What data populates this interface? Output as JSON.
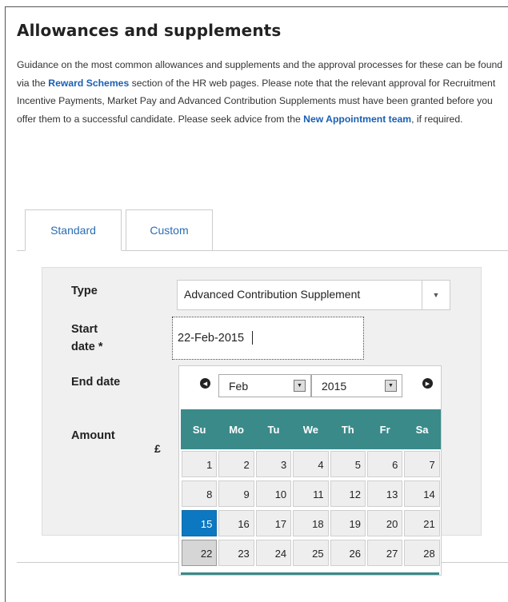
{
  "section": {
    "title": "Allowances and supplements",
    "guidance": {
      "part1": "Guidance on the most common allowances and supplements and the approval processes for these can be found via the ",
      "link1": "Reward Schemes",
      "part2": " section of the HR web pages. Please note that the relevant approval for Recruitment Incentive Payments, Market Pay and Advanced Contribution Supplements must have been granted before you offer them to a successful candidate. Please seek advice from the ",
      "link2": "New Appointment team",
      "part3": ", if required."
    }
  },
  "tabs": [
    {
      "label": "Standard",
      "active": true
    },
    {
      "label": "Custom",
      "active": false
    }
  ],
  "form": {
    "type_label": "Type",
    "type_value": "Advanced Contribution Supplement",
    "start_label_line1": "Start",
    "start_label_line2": "date *",
    "start_value": "22-Feb-2015",
    "end_label": "End date",
    "amount_label": "Amount",
    "currency_symbol": "£"
  },
  "datepicker": {
    "month": "Feb",
    "year": "2015",
    "days_of_week": [
      "Su",
      "Mo",
      "Tu",
      "We",
      "Th",
      "Fr",
      "Sa"
    ],
    "weeks": [
      [
        "1",
        "2",
        "3",
        "4",
        "5",
        "6",
        "7"
      ],
      [
        "8",
        "9",
        "10",
        "11",
        "12",
        "13",
        "14"
      ],
      [
        "15",
        "16",
        "17",
        "18",
        "19",
        "20",
        "21"
      ],
      [
        "22",
        "23",
        "24",
        "25",
        "26",
        "27",
        "28"
      ]
    ],
    "highlighted_day": "15",
    "current_day": "22",
    "highlight_color": "#0d78c2",
    "header_color": "#3a8a8a"
  }
}
